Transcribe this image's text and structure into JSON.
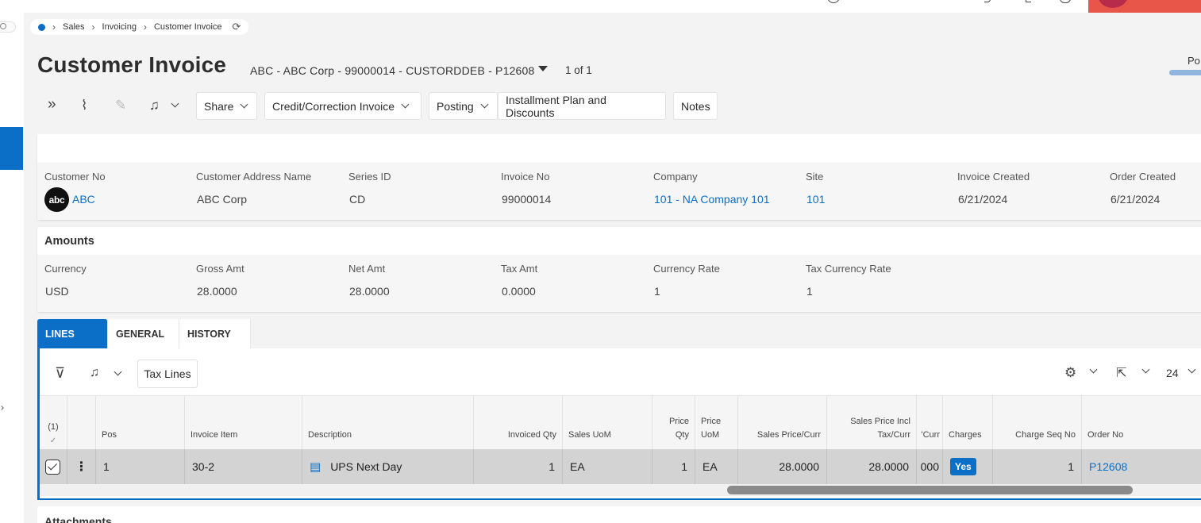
{
  "breadcrumb": {
    "items": [
      "Sales",
      "Invoicing",
      "Customer Invoice"
    ]
  },
  "header": {
    "title": "Customer Invoice",
    "record": "ABC - ABC Corp - 99000014 - CUSTORDDEB - P12608",
    "count": "1 of 1",
    "status": "Po"
  },
  "toolbar": {
    "share": "Share",
    "credit": "Credit/Correction Invoice",
    "posting": "Posting",
    "installment": "Installment Plan and Discounts",
    "notes": "Notes"
  },
  "summary": {
    "labels": {
      "customer_no": "Customer No",
      "address_name": "Customer Address Name",
      "series_id": "Series ID",
      "invoice_no": "Invoice No",
      "company": "Company",
      "site": "Site",
      "invoice_created": "Invoice Created",
      "order_created": "Order Created"
    },
    "values": {
      "logo_text": "abc",
      "customer_no": "ABC",
      "address_name": "ABC Corp",
      "series_id": "CD",
      "invoice_no": "99000014",
      "company": "101 - NA Company 101",
      "site": "101",
      "invoice_created": "6/21/2024",
      "order_created": "6/21/2024"
    }
  },
  "amounts": {
    "title": "Amounts",
    "labels": {
      "currency": "Currency",
      "gross": "Gross Amt",
      "net": "Net Amt",
      "tax": "Tax Amt",
      "currency_rate": "Currency Rate",
      "tax_currency_rate": "Tax Currency Rate"
    },
    "values": {
      "currency": "USD",
      "gross": "28.0000",
      "net": "28.0000",
      "tax": "0.0000",
      "currency_rate": "1",
      "tax_currency_rate": "1"
    }
  },
  "tabs": [
    "LINES",
    "GENERAL",
    "HISTORY"
  ],
  "lines": {
    "tax_lines_button": "Tax Lines",
    "rows_per_page": "24",
    "selected_count": "(1)",
    "columns": {
      "pos": "Pos",
      "invoice_item": "Invoice Item",
      "description": "Description",
      "invoiced_qty": "Invoiced Qty",
      "sales_uom": "Sales UoM",
      "price_qty_1": "Price",
      "price_qty_2": "Qty",
      "price_uom_1": "Price",
      "price_uom_2": "UoM",
      "sales_price_curr": "Sales Price/Curr",
      "sales_price_incl_1": "Sales Price Incl",
      "sales_price_incl_2": "Tax/Curr",
      "partial_curr": "'Curr",
      "charges": "Charges",
      "charge_seq_no": "Charge Seq No",
      "order_no": "Order No"
    },
    "row": {
      "pos": "1",
      "invoice_item": "30-2",
      "description": "UPS Next Day",
      "invoiced_qty": "1",
      "sales_uom": "EA",
      "price_qty": "1",
      "price_uom": "EA",
      "sales_price_curr": "28.0000",
      "sales_price_incl": "28.0000",
      "partial_curr": "000",
      "charges": "Yes",
      "charge_seq_no": "1",
      "order_no": "P12608"
    }
  },
  "attachments": {
    "title": "Attachments"
  },
  "colors": {
    "accent": "#0b6fc7",
    "danger": "#e8564a"
  }
}
